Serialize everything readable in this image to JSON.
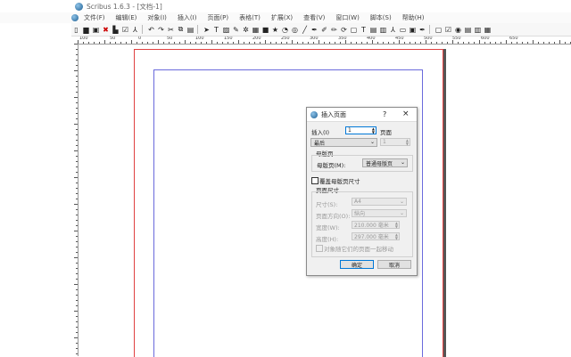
{
  "window": {
    "title": "Scribus 1.6.3 - [文档-1]"
  },
  "menu": [
    "文件(F)",
    "编辑(E)",
    "对象(I)",
    "插入(I)",
    "页面(P)",
    "表格(T)",
    "扩展(X)",
    "查看(V)",
    "窗口(W)",
    "脚本(S)",
    "帮助(H)"
  ],
  "ruler": {
    "h_labels": [
      "100",
      "50",
      "0",
      "50",
      "100",
      "150",
      "200",
      "250",
      "300",
      "350",
      "400",
      "450",
      "500",
      "550",
      "600",
      "650"
    ]
  },
  "dialog": {
    "title": "插入页面",
    "help_glyph": "?",
    "close_glyph": "×",
    "insert_label": "插入(I)",
    "insert_value": "1",
    "insert_unit": "页面",
    "position_value": "最后",
    "position_page": "1",
    "master_group": "母版页",
    "master_label": "母版页(M):",
    "master_value": "普通母版页",
    "override_label": "覆盖母版页尺寸",
    "size_group": "页面尺寸",
    "size_label": "尺寸(S):",
    "size_value": "A4",
    "orientation_label": "页面方向(O):",
    "orientation_value": "纵向",
    "width_label": "宽度(W):",
    "width_value": "210.000 毫米",
    "height_label": "高度(H):",
    "height_value": "297.000 毫米",
    "move_objects_label": "对象随它们的页面一起移动",
    "ok_label": "确定",
    "cancel_label": "取消"
  }
}
